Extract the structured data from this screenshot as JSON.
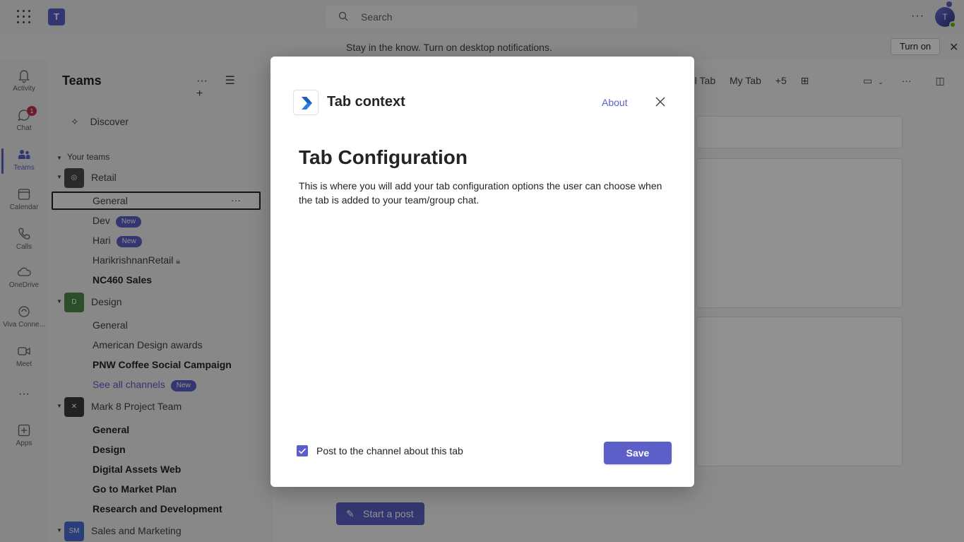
{
  "topbar": {
    "search_placeholder": "Search",
    "app_logo": "T",
    "avatar_initial": "T",
    "more": "···"
  },
  "notification": {
    "message": "Stay in the know. Turn on desktop notifications.",
    "button": "Turn on"
  },
  "rail": {
    "items": [
      {
        "label": "Activity",
        "icon": "bell-icon"
      },
      {
        "label": "Chat",
        "icon": "chat-icon",
        "badge": "1"
      },
      {
        "label": "Teams",
        "icon": "teams-icon",
        "active": true
      },
      {
        "label": "Calendar",
        "icon": "calendar-icon"
      },
      {
        "label": "Calls",
        "icon": "phone-icon"
      },
      {
        "label": "OneDrive",
        "icon": "cloud-icon"
      },
      {
        "label": "Viva Conne...",
        "icon": "viva-icon"
      },
      {
        "label": "Meet",
        "icon": "video-icon"
      },
      {
        "label": "Apps",
        "icon": "apps-icon"
      }
    ],
    "more": "···"
  },
  "panel": {
    "title": "Teams",
    "discover": "Discover",
    "your_teams": "Your teams",
    "teams": [
      {
        "name": "Retail",
        "logo": "",
        "color": "#5b5fc7",
        "channels": [
          "General",
          "Dev",
          "Hari",
          "HarikrishnanRetail",
          "NC460 Sales"
        ]
      },
      {
        "name": "Design",
        "logo": "D",
        "color": "#4f8a4a",
        "channels": [
          "General",
          "American Design awards",
          "PNW Coffee Social Campaign",
          "See all channels"
        ]
      },
      {
        "name": "Mark 8 Project Team",
        "logo": "",
        "color": "#3b3b3b",
        "channels": [
          "General",
          "Design",
          "Digital Assets Web",
          "Go to Market Plan",
          "Research and Development"
        ]
      },
      {
        "name": "Sales and Marketing",
        "logo": "SM",
        "color": "#4a6fd5"
      }
    ],
    "new_label": "New",
    "channel_more": "···"
  },
  "content": {
    "tabs": [
      "el Tab",
      "My Tab",
      "+5"
    ],
    "start_post": "Start a post"
  },
  "dialog": {
    "title": "Tab context",
    "about": "About",
    "heading": "Tab Configuration",
    "description": "This is where you will add your tab configuration options the user can choose when the tab is added to your team/group chat.",
    "checkbox_label": "Post to the channel about this tab",
    "checkbox_checked": true,
    "save": "Save"
  },
  "colors": {
    "accent": "#5b5fc7",
    "badge": "#c4314b"
  }
}
